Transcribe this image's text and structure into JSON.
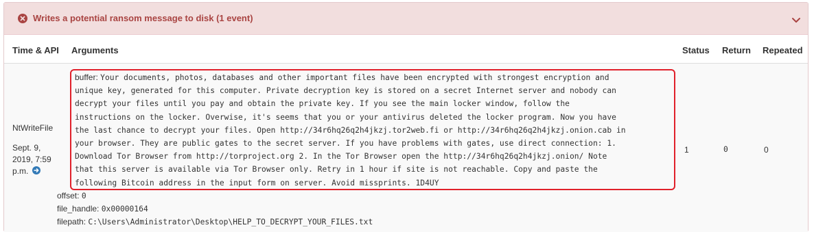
{
  "alert": {
    "title": "Writes a potential ransom message to disk (1 event)",
    "icon": "times-circle-icon",
    "toggle_icon": "chevron-down-icon",
    "background": "#f2dede",
    "color": "#a94442"
  },
  "table": {
    "headers": [
      "Time & API",
      "Arguments",
      "Status",
      "Return",
      "Repeated"
    ],
    "row": {
      "api": "NtWriteFile",
      "time": "Sept. 9, 2019, 7:59 p.m.",
      "arguments": {
        "buffer_key": "buffer:",
        "buffer_lines": [
          "Your documents, photos, databases and other important files have been encrypted with strongest encryption and",
          "unique key, generated for this computer. Private decryption key is stored on a secret Internet server and nobody can",
          "decrypt your files until you pay and obtain the private key. If you see the main locker window, follow the",
          "instructions on the locker. Overwise, it's seems that you or your antivirus deleted the locker program. Now you have",
          "the last chance to decrypt your files. Open http://34r6hq26q2h4jkzj.tor2web.fi or http://34r6hq26q2h4jkzj.onion.cab in",
          "your browser. They are public gates to the secret server. If you have problems with gates, use direct connection: 1.",
          "Download Tor Browser from http://torproject.org 2. In the Tor Browser open the http://34r6hq26q2h4jkzj.onion/ Note",
          "that this server is available via Tor Browser only. Retry in 1 hour if site is not reachable. Copy and paste the",
          "following Bitcoin address in the input form on server. Avoid missprints. 1D4UY"
        ],
        "offset_key": "offset:",
        "offset_val": "0",
        "file_handle_key": "file_handle:",
        "file_handle_val": "0x00000164",
        "filepath_key": "filepath:",
        "filepath_val": "C:\\Users\\Administrator\\Desktop\\HELP_TO_DECRYPT_YOUR_FILES.txt"
      },
      "status": "1",
      "return": "0",
      "repeated": "0"
    }
  },
  "highlight_color": "#e0202a"
}
